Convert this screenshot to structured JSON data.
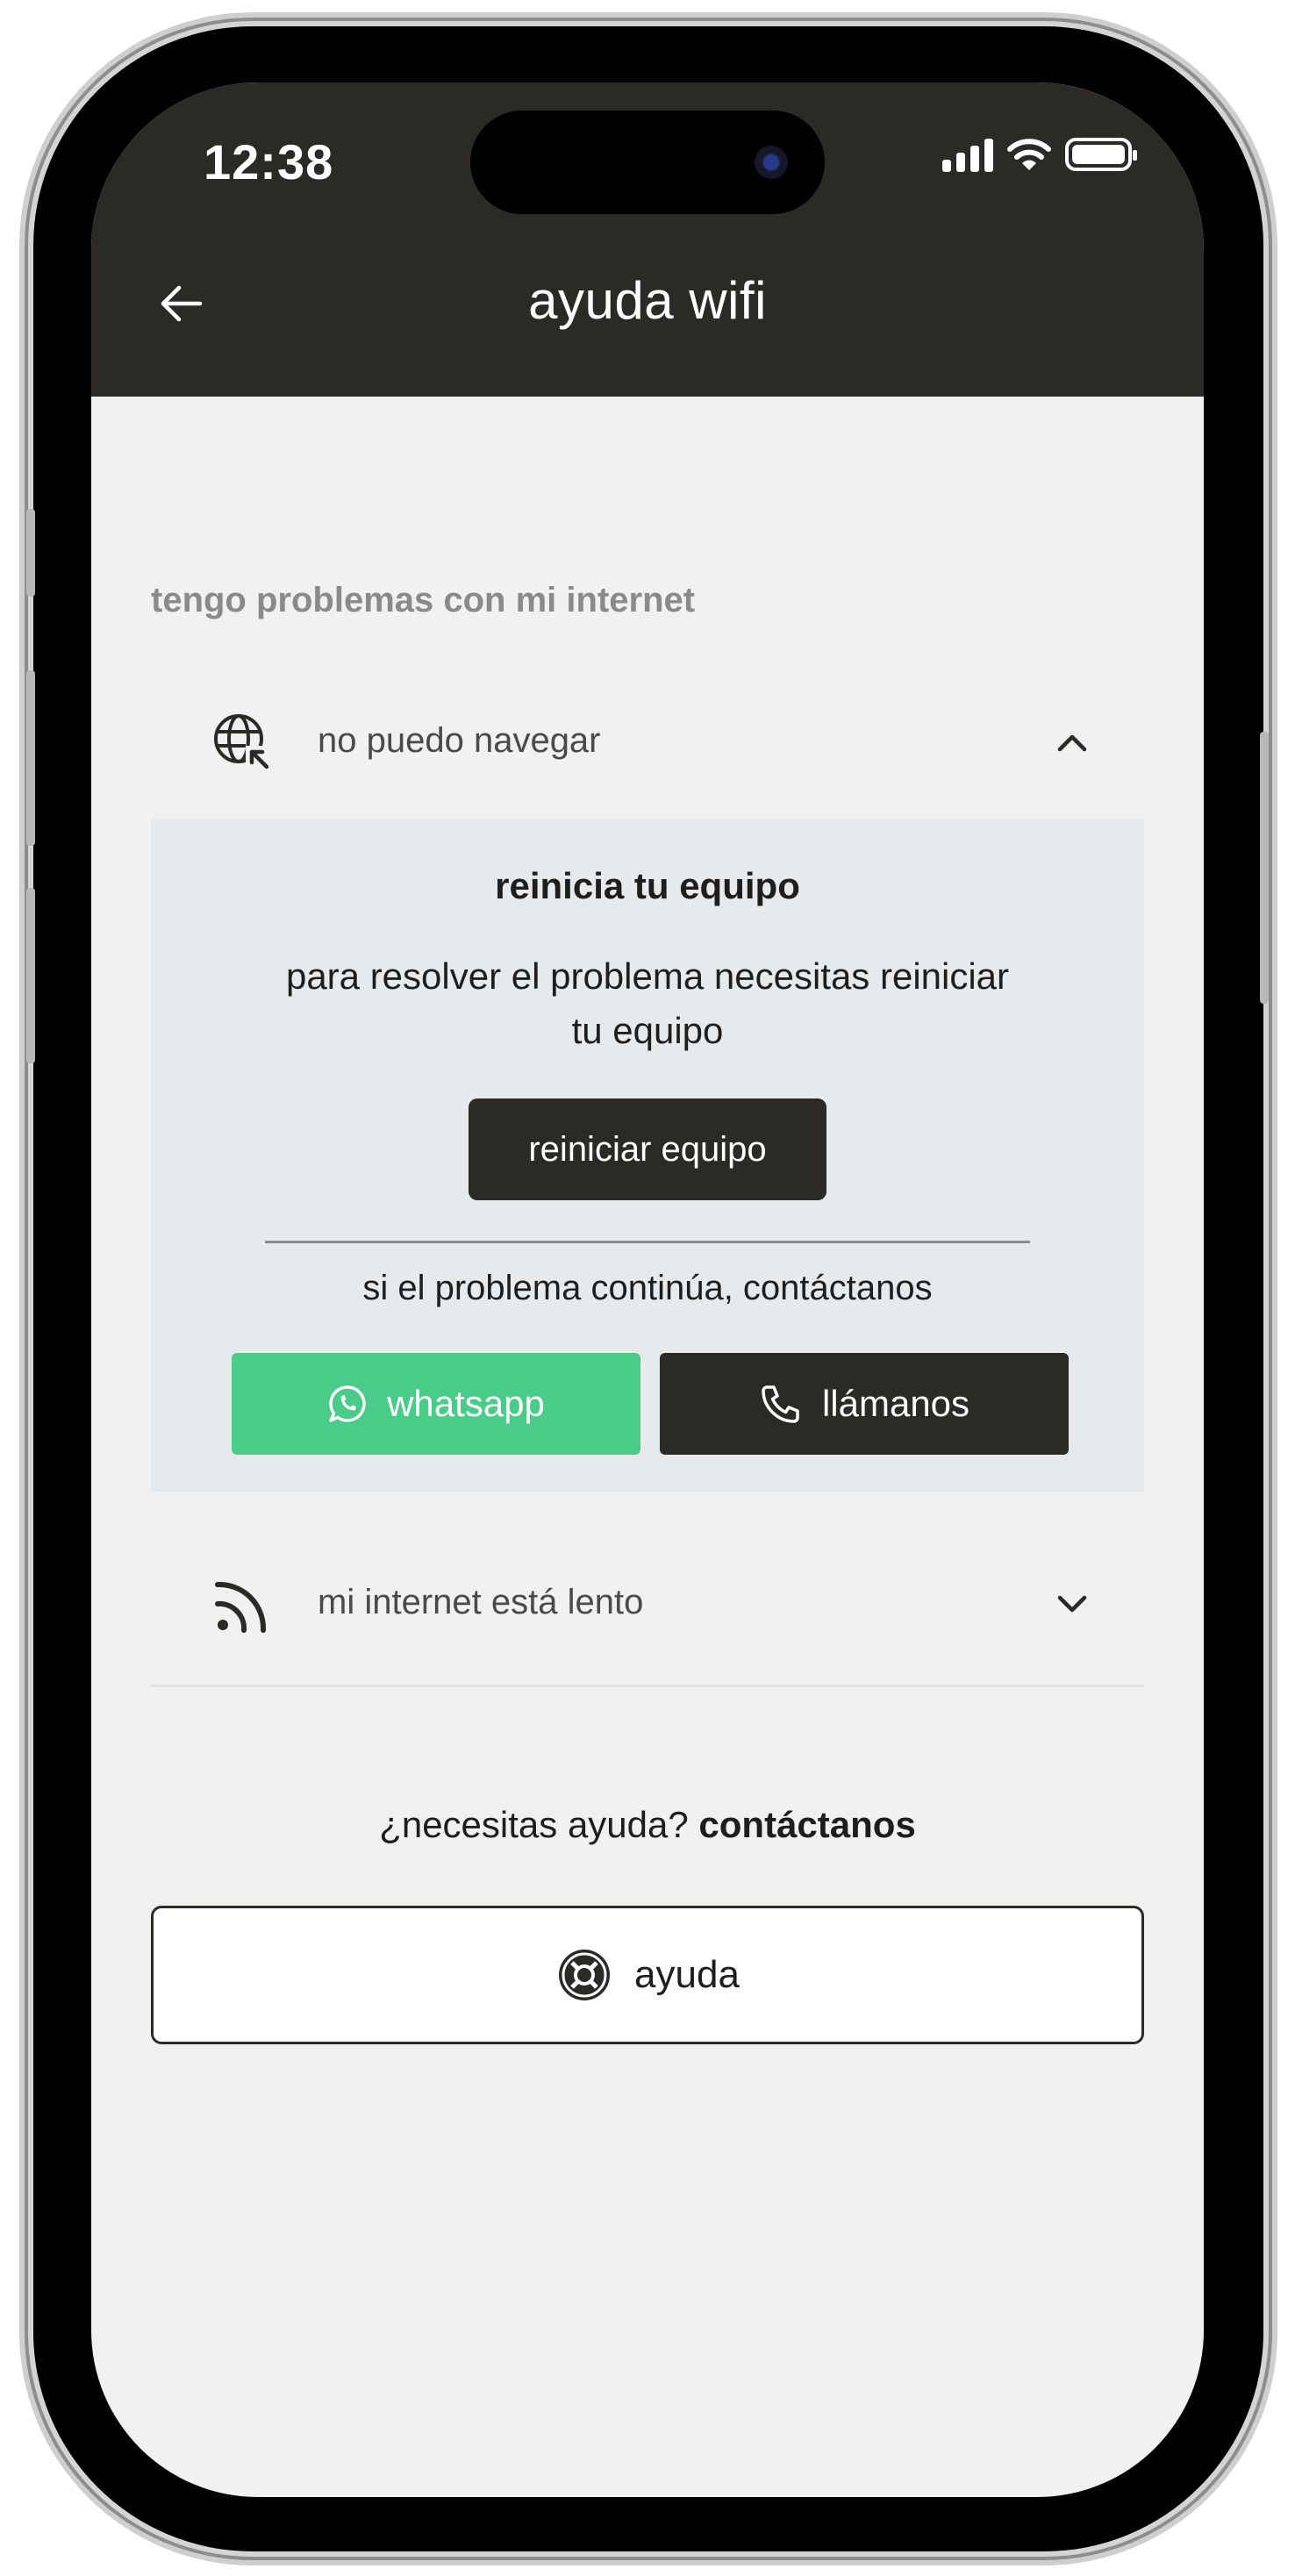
{
  "status_bar": {
    "time": "12:38"
  },
  "header": {
    "title": "ayuda wifi",
    "back_icon": "arrow-left-icon"
  },
  "section": {
    "label": "tengo problemas con mi internet"
  },
  "accordion": [
    {
      "label": "no puedo navegar",
      "icon": "globe-cursor-icon",
      "expanded": true,
      "panel": {
        "title": "reinicia tu equipo",
        "description": "para resolver el problema necesitas reiniciar tu equipo",
        "restart_button": "reiniciar equipo",
        "contact_text": "si el problema continúa, contáctanos",
        "whatsapp_button": "whatsapp",
        "call_button": "llámanos"
      }
    },
    {
      "label": "mi internet está lento",
      "icon": "signal-waves-icon",
      "expanded": false
    }
  ],
  "help": {
    "question": "¿necesitas ayuda?",
    "contact": "contáctanos",
    "button_label": "ayuda",
    "button_icon": "lifebuoy-icon"
  },
  "colors": {
    "header_bg": "#2b2a26",
    "page_bg": "#f0f1f0",
    "panel_bg": "#e7eaec",
    "whatsapp_green": "#48cc88"
  }
}
